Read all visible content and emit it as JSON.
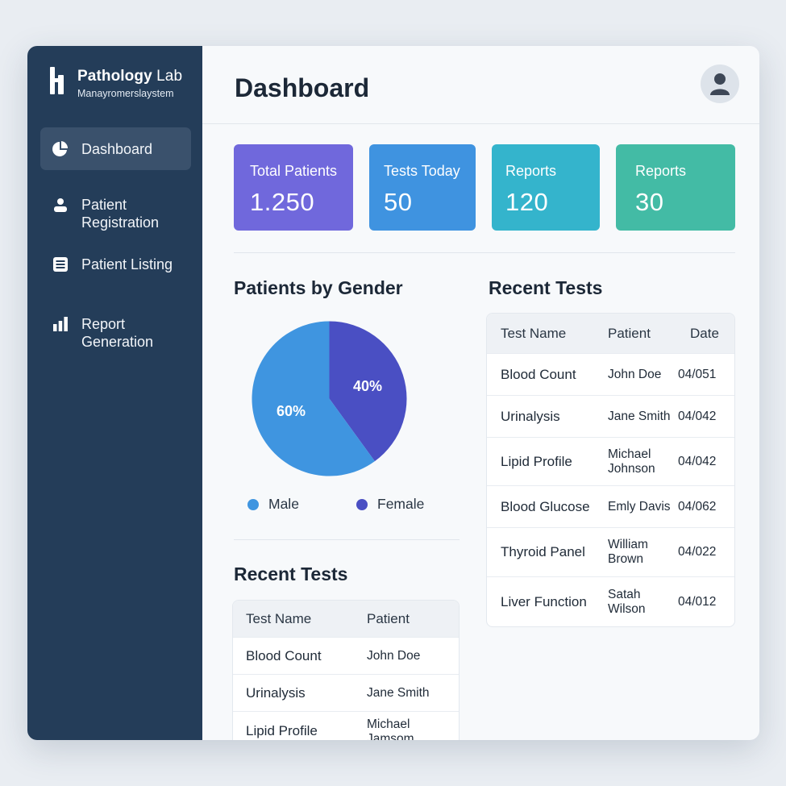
{
  "brand": {
    "title_bold": "Pathology",
    "title_light": "Lab",
    "subtitle": "Manayromerslaystem"
  },
  "nav": [
    {
      "label": "Dashboard",
      "icon": "pie-chart-icon",
      "active": true
    },
    {
      "label": "Patient Registration",
      "icon": "person-icon",
      "active": false
    },
    {
      "label": "Patient Listing",
      "icon": "list-icon",
      "active": false
    },
    {
      "label": "Report Generation",
      "icon": "bar-chart-icon",
      "active": false
    }
  ],
  "header": {
    "title": "Dashboard",
    "avatar_icon": "user-avatar-icon"
  },
  "stats": [
    {
      "label": "Total Patients",
      "value": "1.250"
    },
    {
      "label": "Tests Today",
      "value": "50"
    },
    {
      "label": "Reports",
      "value": "120"
    },
    {
      "label": "Reports",
      "value": "30"
    }
  ],
  "gender_section": {
    "title": "Patients by Gender"
  },
  "chart_data": {
    "type": "pie",
    "title": "Patients by Gender",
    "categories": [
      "Male",
      "Female"
    ],
    "values": [
      60,
      40
    ],
    "labels": [
      "60%",
      "40%"
    ],
    "colors": [
      "#3f95e0",
      "#4a4fc3"
    ],
    "legend_position": "bottom"
  },
  "recent_tests_left": {
    "title": "Recent Tests",
    "headers": [
      "Test Name",
      "Patient"
    ],
    "rows": [
      [
        "Blood Count",
        "John Doe"
      ],
      [
        "Urinalysis",
        "Jane Smith"
      ],
      [
        "Lipid Profile",
        "Michael Jamsom"
      ]
    ]
  },
  "recent_tests_right": {
    "title": "Recent Tests",
    "headers": [
      "Test Name",
      "Patient",
      "Date"
    ],
    "rows": [
      [
        "Blood Count",
        "John Doe",
        "04/051"
      ],
      [
        "Urinalysis",
        "Jane Smith",
        "04/042"
      ],
      [
        "Lipid Profile",
        "Michael Johnson",
        "04/042"
      ],
      [
        "Blood Glucose",
        "Emly Davis",
        "04/062"
      ],
      [
        "Thyroid Panel",
        "William Brown",
        "04/022"
      ],
      [
        "Liver Function",
        "Satah Wilson",
        "04/012"
      ]
    ]
  }
}
